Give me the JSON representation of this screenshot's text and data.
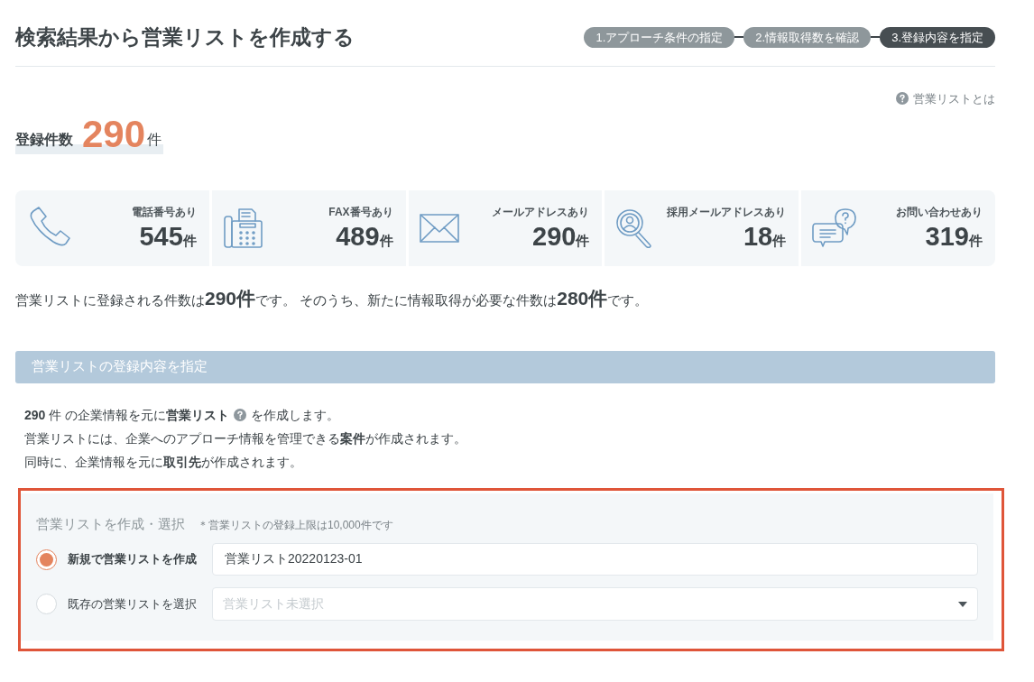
{
  "title": "検索結果から営業リストを作成する",
  "steps": [
    {
      "label": "1.アプローチ条件の指定",
      "selected": false
    },
    {
      "label": "2.情報取得数を確認",
      "selected": false
    },
    {
      "label": "3.登録内容を指定",
      "selected": true
    }
  ],
  "help_link": "営業リストとは",
  "total": {
    "label": "登録件数",
    "value": "290",
    "unit": "件"
  },
  "stats": [
    {
      "kind": "phone",
      "label": "電話番号あり",
      "value": "545",
      "unit": "件"
    },
    {
      "kind": "fax",
      "label": "FAX番号あり",
      "value": "489",
      "unit": "件"
    },
    {
      "kind": "mail",
      "label": "メールアドレスあり",
      "value": "290",
      "unit": "件"
    },
    {
      "kind": "recruit",
      "label": "採用メールアドレスあり",
      "value": "18",
      "unit": "件"
    },
    {
      "kind": "inquiry",
      "label": "お問い合わせあり",
      "value": "319",
      "unit": "件"
    }
  ],
  "summary": "営業リストに登録される件数は**290件**です。 そのうち、新たに情報取得が必要な件数は**280件**です。",
  "section": {
    "title": "営業リストの登録内容を指定",
    "intro_start": "**290** 件 の企業情報を元に**営業リスト**",
    "intro_end": "を作成します。",
    "lines": [
      "営業リストには、企業へのアプローチ情報を管理できる**案件**が作成されます。",
      "同時に、企業情報を元に**取引先**が作成されます。"
    ]
  },
  "form": {
    "title": "営業リストを作成・選択",
    "note": "＊営業リストの登録上限は10,000件です",
    "options": [
      {
        "kind": "input",
        "label": "新規で営業リストを作成",
        "selected": true,
        "value": "営業リスト20220123-01"
      },
      {
        "kind": "select",
        "label": "既存の営業リストを選択",
        "selected": false,
        "placeholder": "営業リスト未選択"
      }
    ]
  }
}
